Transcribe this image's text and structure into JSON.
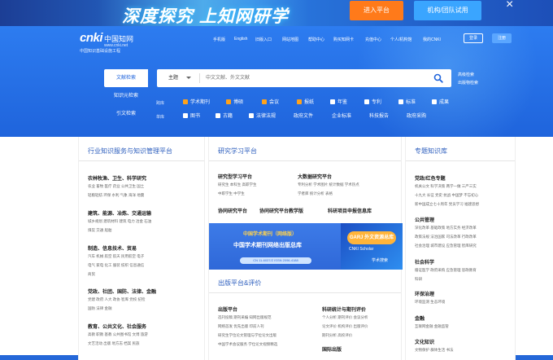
{
  "banner": {
    "title": "深度探究 上知网研学",
    "enter_button": "进入平台",
    "org_button": "机构/团队试用",
    "close_icon": "close-icon",
    "colors": {
      "orange": "#ff7a1a",
      "blue": "#3aa5ff"
    }
  },
  "header": {
    "logo_main": "cnki",
    "logo_cn": "中国知网",
    "logo_url": "www.cnki.net",
    "logo_sub": "中国知识基础设施工程",
    "nav": [
      "手机版",
      "English",
      "旧版入口",
      "网站地图",
      "帮助中心",
      "购买知网卡",
      "充值中心",
      "个人/机构馆",
      "我的CNKI"
    ],
    "login_button": "登录",
    "register_button": "注册"
  },
  "search": {
    "tabs": [
      "文献检索",
      "知识元检索",
      "引文检索"
    ],
    "active_tab": 0,
    "field": "主题",
    "placeholder": "中文文献、外文文献",
    "advanced": "高级检索",
    "publication": "出版物检索",
    "row1_label": "跨库",
    "row2_label": "单库",
    "row1": [
      {
        "label": "学术期刊",
        "checked": true
      },
      {
        "label": "博硕",
        "checked": true
      },
      {
        "label": "会议",
        "checked": true
      },
      {
        "label": "报纸",
        "checked": true
      },
      {
        "label": "年鉴",
        "checked": false
      },
      {
        "label": "专利",
        "checked": false
      },
      {
        "label": "标准",
        "checked": false
      },
      {
        "label": "成果",
        "checked": false
      }
    ],
    "row2": [
      "图书",
      "古籍",
      "法律法规",
      "政府文件",
      "企业标准",
      "科技报告",
      "政府采购"
    ]
  },
  "col1": {
    "title": "行业知识服务与知识管理平台",
    "groups": [
      {
        "name": "农林牧渔、卫生、科学研究",
        "subs": [
          "农业  畜牧  医疗  药业  公共卫生  国土",
          "轻粮轻纺  环保  水利  气象  海洋  地震"
        ]
      },
      {
        "name": "建筑、能源、冶炼、交通运输",
        "subs": [
          "城乡规划  建筑材料  建筑  电力  冶金  石油",
          "煤炭  交通  船舶"
        ]
      },
      {
        "name": "制造、信息技术、贸易",
        "subs": [
          "汽车  机械  航空  航天  民用航空  电子",
          "电气  家电  化工  服装  纺织  信息通信",
          "商贸"
        ]
      },
      {
        "name": "党政、社团、国防、法律、金融",
        "subs": [
          "党建  政府  人大  政协  智库  党校  纪检",
          "国防  法律  金融"
        ]
      },
      {
        "name": "教育、公共文化、社会服务",
        "subs": [
          "高教  职教  基教  公共图书馆  文博  旅游",
          "文艺活动  出版  地方志  档案  民族"
        ]
      }
    ]
  },
  "col2": {
    "title": "研究学习平台",
    "sections": [
      {
        "name": "研究型学习平台",
        "subs": [
          "研究生  本科生  高职学生",
          "中职学生  中学生"
        ]
      },
      {
        "name": "大数据研究平台",
        "subs": [
          "专利分析  学术图片  统计数据  学术热点",
          "学者库  统计分析  表格"
        ]
      }
    ],
    "links": [
      "协同研究平台",
      "协同研究平台教学版",
      "科研项目申报信息库"
    ],
    "promo_left_title": "中国学术期刊（网络版）",
    "promo_left_sub": "中国学术期刊网络出版总库",
    "promo_left_cn": "CN 11-6037/Z   ISSN 2096-4188",
    "promo_right_title": "GARJ 外文资源总库",
    "promo_right_sub": "CNKI Scholar",
    "promo_right_cap": "学术搜索",
    "publish_title": "出版平台&评价",
    "publish_left_head": "出版平台",
    "publish_left_subs": [
      "选刊投稿  期刊采编  知网出版规范",
      "网络首发  优先出版  印前人刊",
      "研究生学位论文管理与学位论文出版",
      "中国学术会议服务  学位论文视频精选"
    ],
    "publish_right_head": "科研统计与期刊评价",
    "publish_right_subs": [
      "个人分析  期刊评价  会议分析",
      "论文评价  机构评价  出版评价",
      "期刊分析  高校评价"
    ],
    "publish_right_bottom": "国际出版"
  },
  "col3": {
    "title": "专题知识库",
    "groups": [
      {
        "name": "党政/红色专题",
        "subs": [
          "机关公文  科学决策  两学一做  三严三实",
          "十九大  长征  党史  抗战  中国梦  不忘初心",
          "新中国成立七十周年  党员学习  福建思想"
        ]
      },
      {
        "name": "公共管理",
        "subs": [
          "深化改革  基础政策  地方实务  经济改革",
          "政策法规  法治国家  司法改革  行政改革",
          "社会治理  城市建设  应急管理  智库研究"
        ]
      },
      {
        "name": "社会科学",
        "subs": [
          "循证医学  政府采购  应急管理  思政教育",
          "科研"
        ]
      },
      {
        "name": "环保治理",
        "subs": [
          "环境监测  生态环境"
        ]
      },
      {
        "name": "金融",
        "subs": [
          "互联网金融  金融监管"
        ]
      },
      {
        "name": "文化知识",
        "subs": [
          "文物保护  群体生活  书法"
        ]
      }
    ]
  }
}
